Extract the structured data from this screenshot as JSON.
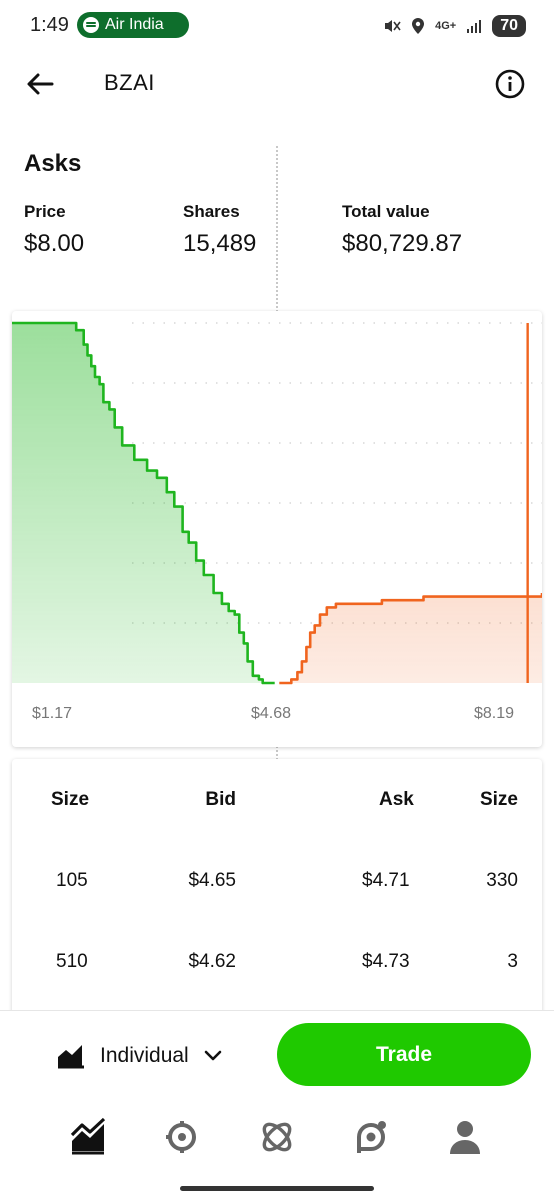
{
  "status_bar": {
    "time": "1:49",
    "media_pill": "Air India",
    "network": "4G+",
    "battery": "70"
  },
  "header": {
    "symbol": "BZAI"
  },
  "asks": {
    "title": "Asks",
    "price_label": "Price",
    "price_value": "$8.00",
    "shares_label": "Shares",
    "shares_value": "15,489",
    "total_label": "Total value",
    "total_value": "$80,729.87"
  },
  "chart_data": {
    "type": "area",
    "x_ticks": [
      "$1.17",
      "$4.68",
      "$8.19"
    ],
    "xlim": [
      1.17,
      8.19
    ],
    "selected_price": 8.0,
    "colors": {
      "bids": "#1fb51f",
      "asks": "#f0641e"
    },
    "series": [
      {
        "name": "Bids",
        "x": [
          1.17,
          1.97,
          2.02,
          2.12,
          2.17,
          2.22,
          2.27,
          2.33,
          2.38,
          2.46,
          2.53,
          2.63,
          2.79,
          2.96,
          3.09,
          3.22,
          3.32,
          3.43,
          3.51,
          3.61,
          3.71,
          3.84,
          3.95,
          4.04,
          4.12,
          4.18,
          4.24,
          4.29,
          4.36,
          4.44,
          4.49,
          4.57,
          4.65,
          4.65
        ],
        "y": [
          1.0,
          1.0,
          0.98,
          0.94,
          0.91,
          0.88,
          0.85,
          0.83,
          0.78,
          0.76,
          0.71,
          0.66,
          0.62,
          0.59,
          0.57,
          0.53,
          0.49,
          0.42,
          0.39,
          0.34,
          0.3,
          0.25,
          0.22,
          0.2,
          0.19,
          0.14,
          0.11,
          0.06,
          0.02,
          0.01,
          0.0,
          0.0,
          0.0,
          0.0
        ]
      },
      {
        "name": "Asks",
        "x": [
          4.71,
          4.87,
          4.95,
          5.01,
          5.07,
          5.12,
          5.18,
          5.25,
          5.34,
          5.46,
          5.61,
          6.07,
          6.38,
          6.62,
          6.76,
          7.04,
          7.4,
          8.19
        ],
        "y": [
          0.0,
          0.01,
          0.03,
          0.06,
          0.1,
          0.14,
          0.16,
          0.19,
          0.21,
          0.22,
          0.22,
          0.23,
          0.23,
          0.24,
          0.24,
          0.24,
          0.24,
          0.25
        ]
      }
    ]
  },
  "order_book": {
    "headers": {
      "size_left": "Size",
      "bid": "Bid",
      "ask": "Ask",
      "size_right": "Size"
    },
    "rows": [
      {
        "bid_size": "105",
        "bid": "$4.65",
        "ask": "$4.71",
        "ask_size": "330"
      },
      {
        "bid_size": "510",
        "bid": "$4.62",
        "ask": "$4.73",
        "ask_size": "3"
      }
    ]
  },
  "bottom_bar": {
    "account": "Individual",
    "trade_label": "Trade",
    "nav_icons": [
      "investing-icon",
      "crypto-icon",
      "discover-icon",
      "notifications-icon",
      "account-icon"
    ]
  }
}
